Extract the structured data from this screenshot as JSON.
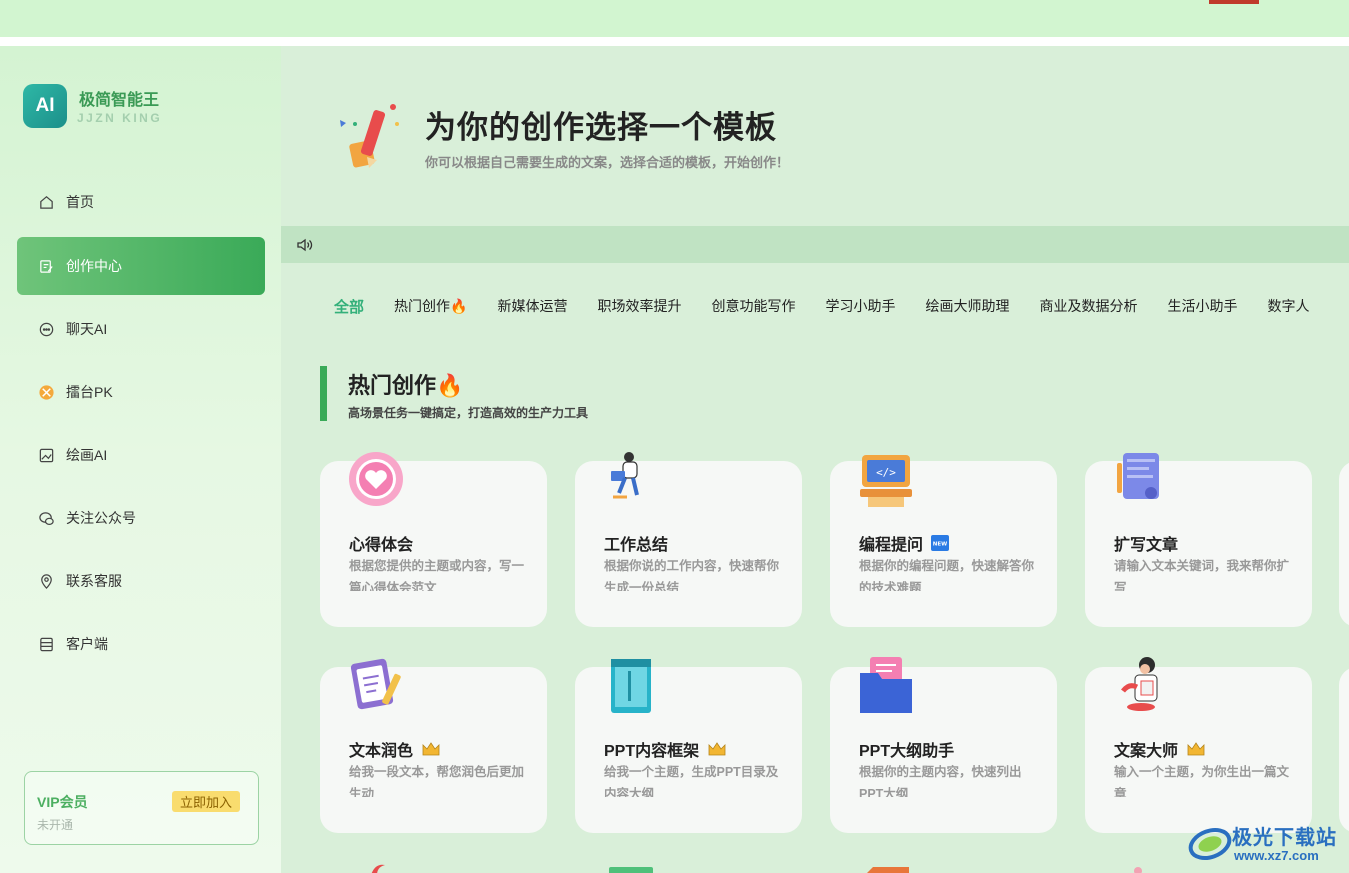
{
  "brand": {
    "logo_text": "AI",
    "name": "极简智能王",
    "subtitle": "JJZN KING"
  },
  "nav": [
    {
      "label": "首页",
      "icon": "home-icon"
    },
    {
      "label": "创作中心",
      "icon": "edit-doc-icon",
      "active": true
    },
    {
      "label": "聊天AI",
      "icon": "chat-icon"
    },
    {
      "label": "擂台PK",
      "icon": "pk-icon"
    },
    {
      "label": "绘画AI",
      "icon": "painting-icon"
    },
    {
      "label": "关注公众号",
      "icon": "wechat-icon"
    },
    {
      "label": "联系客服",
      "icon": "location-icon"
    },
    {
      "label": "客户端",
      "icon": "app-icon"
    }
  ],
  "vip": {
    "title": "VIP会员",
    "status": "未开通",
    "join_label": "立即加入"
  },
  "hero": {
    "title": "为你的创作选择一个模板",
    "subtitle": "你可以根据自己需要生成的文案，选择合适的模板，开始创作！"
  },
  "tabs": [
    "全部",
    "热门创作🔥",
    "新媒体运营",
    "职场效率提升",
    "创意功能写作",
    "学习小助手",
    "绘画大师助理",
    "商业及数据分析",
    "生活小助手",
    "数字人"
  ],
  "section": {
    "title": "热门创作🔥",
    "subtitle": "高场景任务一键搞定，打造高效的生产力工具"
  },
  "cards": [
    {
      "title": "心得体会",
      "desc": "根据您提供的主题或内容，写一篇心得体会范文",
      "icon": "heart-icon",
      "badge": ""
    },
    {
      "title": "工作总结",
      "desc": "根据你说的工作内容，快速帮你生成一份总结",
      "icon": "person-working-icon",
      "badge": ""
    },
    {
      "title": "编程提问",
      "desc": "根据你的编程问题，快速解答你的技术难题",
      "icon": "code-monitor-icon",
      "badge": "NEW"
    },
    {
      "title": "扩写文章",
      "desc": "请输入文本关键词，我来帮你扩写",
      "icon": "document-pen-icon",
      "badge": ""
    },
    {
      "title": "文本润色",
      "desc": "给我一段文本，帮您润色后更加生动",
      "icon": "clipboard-pen-icon",
      "badge": "vip"
    },
    {
      "title": "PPT内容框架",
      "desc": "给我一个主题，生成PPT目录及内容大纲",
      "icon": "book-icon",
      "badge": "vip"
    },
    {
      "title": "PPT大纲助手",
      "desc": "根据你的主题内容，快速列出PPT大纲",
      "icon": "folder-icon",
      "badge": ""
    },
    {
      "title": "文案大师",
      "desc": "输入一个主题，为你生出一篇文章",
      "icon": "writer-icon",
      "badge": "vip"
    }
  ],
  "watermark": {
    "name": "极光下载站",
    "url": "www.xz7.com"
  }
}
